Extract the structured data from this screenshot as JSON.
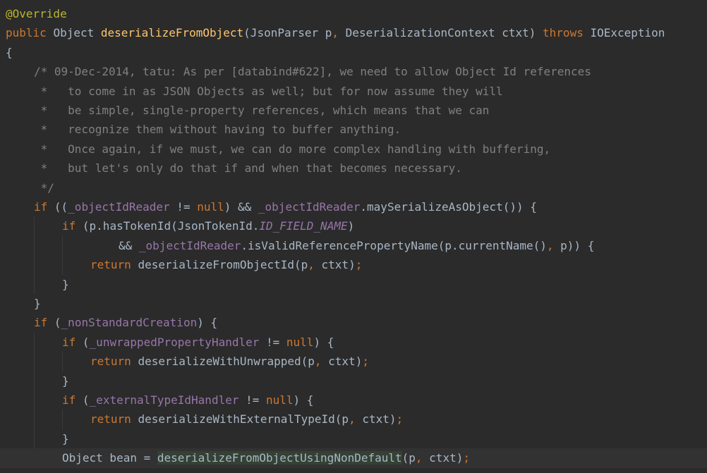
{
  "editor": {
    "lines": [
      {
        "indent": 0,
        "tokens": [
          {
            "type": "annotation",
            "text": "@Override"
          }
        ]
      },
      {
        "indent": 0,
        "tokens": [
          {
            "type": "keyword",
            "text": "public "
          },
          {
            "type": "plain",
            "text": "Object "
          },
          {
            "type": "method",
            "text": "deserializeFromObject"
          },
          {
            "type": "plain",
            "text": "(JsonParser p"
          },
          {
            "type": "punct",
            "text": ", "
          },
          {
            "type": "plain",
            "text": "DeserializationContext ctxt) "
          },
          {
            "type": "keyword",
            "text": "throws "
          },
          {
            "type": "plain",
            "text": "IOException"
          }
        ]
      },
      {
        "indent": 0,
        "tokens": [
          {
            "type": "plain",
            "text": "{"
          }
        ]
      },
      {
        "indent": 4,
        "tokens": [
          {
            "type": "comment",
            "text": "/* 09-Dec-2014, tatu: As per [databind#622], we need to allow Object Id references"
          }
        ]
      },
      {
        "indent": 4,
        "tokens": [
          {
            "type": "comment",
            "text": " *   to come in as JSON Objects as well; but for now assume they will"
          }
        ]
      },
      {
        "indent": 4,
        "tokens": [
          {
            "type": "comment",
            "text": " *   be simple, single-property references, which means that we can"
          }
        ]
      },
      {
        "indent": 4,
        "tokens": [
          {
            "type": "comment",
            "text": " *   recognize them without having to buffer anything."
          }
        ]
      },
      {
        "indent": 4,
        "tokens": [
          {
            "type": "comment",
            "text": " *   Once again, if we must, we can do more complex handling with buffering,"
          }
        ]
      },
      {
        "indent": 4,
        "tokens": [
          {
            "type": "comment",
            "text": " *   but let's only do that if and when that becomes necessary."
          }
        ]
      },
      {
        "indent": 4,
        "tokens": [
          {
            "type": "comment",
            "text": " */"
          }
        ]
      },
      {
        "indent": 4,
        "tokens": [
          {
            "type": "keyword",
            "text": "if "
          },
          {
            "type": "plain",
            "text": "(("
          },
          {
            "type": "field",
            "text": "_objectIdReader"
          },
          {
            "type": "plain",
            "text": " != "
          },
          {
            "type": "keyword",
            "text": "null"
          },
          {
            "type": "plain",
            "text": ") && "
          },
          {
            "type": "field",
            "text": "_objectIdReader"
          },
          {
            "type": "plain",
            "text": ".maySerializeAsObject()) {"
          }
        ]
      },
      {
        "indent": 8,
        "tokens": [
          {
            "type": "keyword",
            "text": "if "
          },
          {
            "type": "plain",
            "text": "(p.hasTokenId(JsonTokenId."
          },
          {
            "type": "constant",
            "text": "ID_FIELD_NAME"
          },
          {
            "type": "plain",
            "text": ")"
          }
        ]
      },
      {
        "indent": 16,
        "tokens": [
          {
            "type": "plain",
            "text": "&& "
          },
          {
            "type": "field",
            "text": "_objectIdReader"
          },
          {
            "type": "plain",
            "text": ".isValidReferencePropertyName(p.currentName()"
          },
          {
            "type": "punct",
            "text": ", "
          },
          {
            "type": "plain",
            "text": "p)) {"
          }
        ]
      },
      {
        "indent": 12,
        "tokens": [
          {
            "type": "keyword",
            "text": "return "
          },
          {
            "type": "plain",
            "text": "deserializeFromObjectId(p"
          },
          {
            "type": "punct",
            "text": ", "
          },
          {
            "type": "plain",
            "text": "ctxt)"
          },
          {
            "type": "punct",
            "text": ";"
          }
        ]
      },
      {
        "indent": 8,
        "tokens": [
          {
            "type": "plain",
            "text": "}"
          }
        ]
      },
      {
        "indent": 4,
        "tokens": [
          {
            "type": "plain",
            "text": "}"
          }
        ]
      },
      {
        "indent": 4,
        "tokens": [
          {
            "type": "keyword",
            "text": "if "
          },
          {
            "type": "plain",
            "text": "("
          },
          {
            "type": "field",
            "text": "_nonStandardCreation"
          },
          {
            "type": "plain",
            "text": ") {"
          }
        ]
      },
      {
        "indent": 8,
        "tokens": [
          {
            "type": "keyword",
            "text": "if "
          },
          {
            "type": "plain",
            "text": "("
          },
          {
            "type": "field",
            "text": "_unwrappedPropertyHandler"
          },
          {
            "type": "plain",
            "text": " != "
          },
          {
            "type": "keyword",
            "text": "null"
          },
          {
            "type": "plain",
            "text": ") {"
          }
        ]
      },
      {
        "indent": 12,
        "tokens": [
          {
            "type": "keyword",
            "text": "return "
          },
          {
            "type": "plain",
            "text": "deserializeWithUnwrapped(p"
          },
          {
            "type": "punct",
            "text": ", "
          },
          {
            "type": "plain",
            "text": "ctxt)"
          },
          {
            "type": "punct",
            "text": ";"
          }
        ]
      },
      {
        "indent": 8,
        "tokens": [
          {
            "type": "plain",
            "text": "}"
          }
        ]
      },
      {
        "indent": 8,
        "tokens": [
          {
            "type": "keyword",
            "text": "if "
          },
          {
            "type": "plain",
            "text": "("
          },
          {
            "type": "field",
            "text": "_externalTypeIdHandler"
          },
          {
            "type": "plain",
            "text": " != "
          },
          {
            "type": "keyword",
            "text": "null"
          },
          {
            "type": "plain",
            "text": ") {"
          }
        ]
      },
      {
        "indent": 12,
        "tokens": [
          {
            "type": "keyword",
            "text": "return "
          },
          {
            "type": "plain",
            "text": "deserializeWithExternalTypeId(p"
          },
          {
            "type": "punct",
            "text": ", "
          },
          {
            "type": "plain",
            "text": "ctxt)"
          },
          {
            "type": "punct",
            "text": ";"
          }
        ]
      },
      {
        "indent": 8,
        "tokens": [
          {
            "type": "plain",
            "text": "}"
          }
        ]
      },
      {
        "indent": 8,
        "current": true,
        "tokens": [
          {
            "type": "plain",
            "text": "Object bean = "
          },
          {
            "type": "highlight",
            "text": "deserializeFromObjectUsingNonDefault"
          },
          {
            "type": "plain",
            "text": "(p"
          },
          {
            "type": "punct",
            "text": ", "
          },
          {
            "type": "plain",
            "text": "ctxt)"
          },
          {
            "type": "punct",
            "text": ";"
          }
        ]
      }
    ]
  }
}
